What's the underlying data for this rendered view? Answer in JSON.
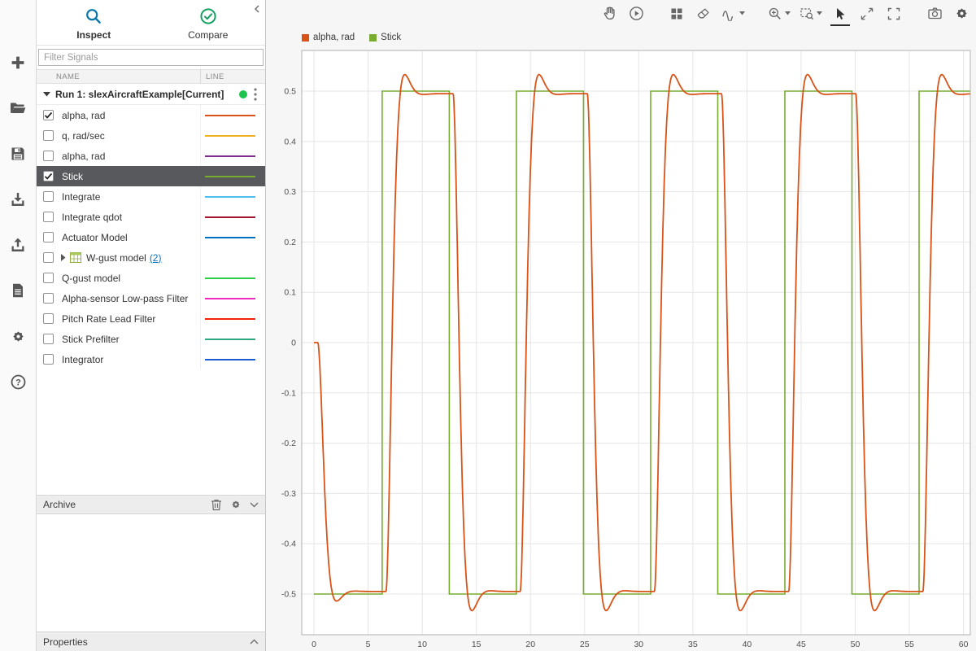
{
  "left_toolbar": {
    "items": [
      {
        "icon": "add",
        "name": "new"
      },
      {
        "icon": "open",
        "name": "open"
      },
      {
        "icon": "save",
        "name": "save"
      },
      {
        "icon": "import",
        "name": "import"
      },
      {
        "icon": "export",
        "name": "export"
      },
      {
        "icon": "report",
        "name": "create-report"
      },
      {
        "icon": "settings",
        "name": "preferences"
      },
      {
        "icon": "help",
        "name": "help"
      }
    ]
  },
  "tabs": {
    "inspect": "Inspect",
    "compare": "Compare"
  },
  "filter": {
    "placeholder": "Filter Signals"
  },
  "table": {
    "name_header": "NAME",
    "line_header": "LINE"
  },
  "run": {
    "label": "Run 1: slexAircraftExample[Current]",
    "status_color": "#1fc24d"
  },
  "signals": [
    {
      "name": "alpha, rad",
      "checked": true,
      "color": "#d95319"
    },
    {
      "name": "q, rad/sec",
      "checked": false,
      "color": "#edb120"
    },
    {
      "name": "alpha, rad",
      "checked": false,
      "color": "#7e2f8e"
    },
    {
      "name": "Stick",
      "checked": true,
      "color": "#77ac30",
      "selected": true
    },
    {
      "name": "Integrate",
      "checked": false,
      "color": "#4dbeee"
    },
    {
      "name": "Integrate qdot",
      "checked": false,
      "color": "#a2142f"
    },
    {
      "name": "Actuator Model",
      "checked": false,
      "color": "#0072bd"
    },
    {
      "name": "W-gust model",
      "checked": false,
      "group": true,
      "count_label": "(2)"
    },
    {
      "name": "Q-gust model",
      "checked": false,
      "color": "#2dce49"
    },
    {
      "name": "Alpha-sensor Low-pass Filter",
      "checked": false,
      "color": "#ef2bbf"
    },
    {
      "name": "Pitch Rate Lead Filter",
      "checked": false,
      "color": "#f4220c"
    },
    {
      "name": "Stick Prefilter",
      "checked": false,
      "color": "#2fa881"
    },
    {
      "name": "Integrator",
      "checked": false,
      "color": "#1d5bd2"
    }
  ],
  "archive": {
    "label": "Archive"
  },
  "properties": {
    "label": "Properties"
  },
  "plot_toolbar": {
    "items": [
      {
        "icon": "pan",
        "name": "pan-tool"
      },
      {
        "icon": "replay",
        "name": "replay",
        "gap_after": true
      },
      {
        "icon": "layout",
        "name": "subplot-layout"
      },
      {
        "icon": "eraser",
        "name": "clear-plots"
      },
      {
        "icon": "signal-wave",
        "name": "signal-style",
        "caret": true,
        "gap_after": true
      },
      {
        "icon": "zoom-in",
        "name": "zoom-in",
        "caret": true
      },
      {
        "icon": "zoom-region",
        "name": "zoom-region",
        "caret": true
      },
      {
        "icon": "cursor",
        "name": "select-tool",
        "selected": true
      },
      {
        "icon": "expand",
        "name": "expand-axes"
      },
      {
        "icon": "fit",
        "name": "fit-to-view",
        "gap_after": true
      },
      {
        "icon": "camera",
        "name": "snapshot"
      },
      {
        "icon": "settings",
        "name": "plot-settings"
      }
    ]
  },
  "chart_data": {
    "type": "line",
    "title": "",
    "xlabel": "",
    "ylabel": "",
    "grid": true,
    "legend_position": "top-left",
    "xlim": [
      -1.13,
      60.63
    ],
    "ylim": [
      -0.581,
      0.581
    ],
    "xticks": [
      0,
      5,
      10,
      15,
      20,
      25,
      30,
      35,
      40,
      45,
      50,
      55,
      60
    ],
    "yticks": [
      0.5,
      0.4,
      0.3,
      0.2,
      0.1,
      0,
      -0.1,
      -0.2,
      -0.3,
      -0.4,
      -0.5
    ],
    "series": [
      {
        "name": "alpha, rad",
        "color": "#d95319",
        "type": "response",
        "start_value": 0,
        "peak_value": 0.53,
        "settled_value": 0.495,
        "model": {
          "wn": 2.6,
          "zeta": 0.72,
          "dead_time": 0.35,
          "dc_gain": 0.99
        }
      },
      {
        "name": "Stick",
        "color": "#77ac30",
        "type": "square",
        "initial_level": -0.5,
        "t_start": 0,
        "t_end": 60.6,
        "edges": [
          {
            "t": 6.3,
            "level": 0.5
          },
          {
            "t": 12.5,
            "level": -0.5
          },
          {
            "t": 18.7,
            "level": 0.5
          },
          {
            "t": 24.9,
            "level": -0.5
          },
          {
            "t": 31.1,
            "level": 0.5
          },
          {
            "t": 37.3,
            "level": -0.5
          },
          {
            "t": 43.5,
            "level": 0.5
          },
          {
            "t": 49.7,
            "level": -0.5
          },
          {
            "t": 55.9,
            "level": 0.5
          }
        ]
      }
    ]
  }
}
